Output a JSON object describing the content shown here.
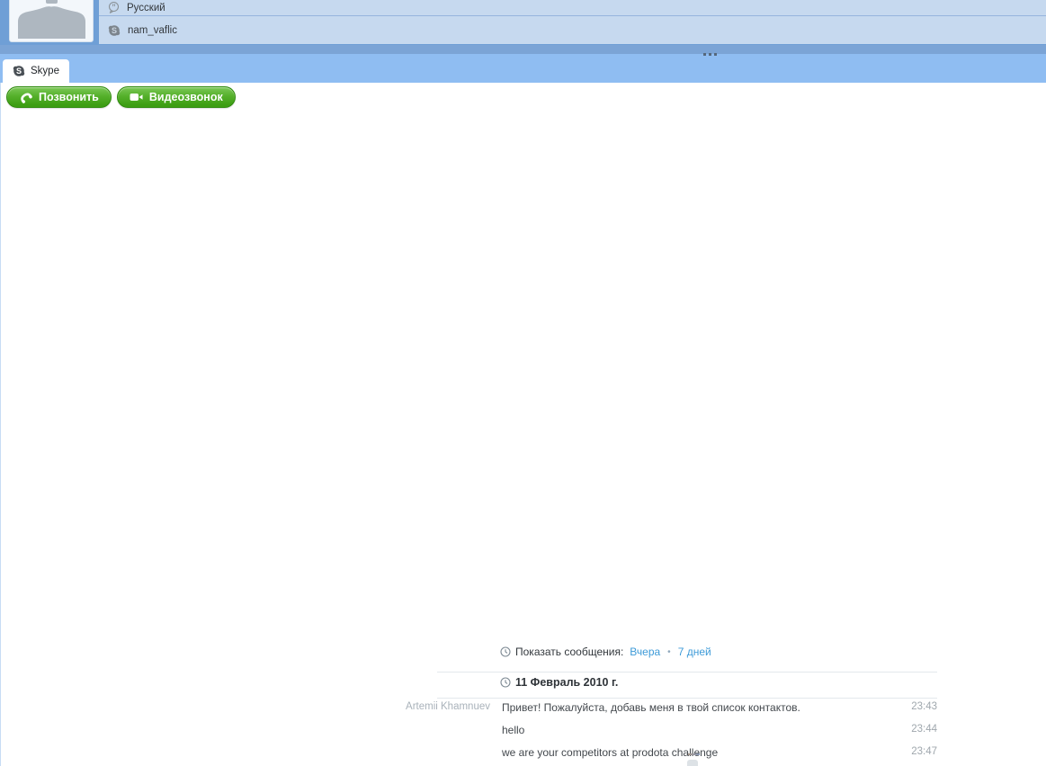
{
  "header": {
    "mood_message": "Русский",
    "skype_name": "nam_vaflic"
  },
  "tab": {
    "label": "Skype"
  },
  "toolbar": {
    "call_label": "Позвонить",
    "video_call_label": "Видеозвонок"
  },
  "history": {
    "show_messages_label": "Показать сообщения:",
    "link_yesterday": "Вчера",
    "separator": "•",
    "link_7days": "7 дней",
    "date_header": "11 Февраль 2010 г.",
    "messages": [
      {
        "author": "Artemii Khamnuev",
        "text": "Привет! Пожалуйста, добавь меня в твой список контактов.",
        "time": "23:43"
      },
      {
        "author": "",
        "text": "hello",
        "time": "23:44"
      },
      {
        "author": "",
        "text": "we are your competitors at prodota challenge",
        "time": "23:47"
      }
    ]
  },
  "icons": {
    "avatar": "default-person-silhouette",
    "mood": "speech-bubble",
    "skype": "skype-cloud",
    "clock": "clock",
    "call": "phone-handset",
    "video": "video-camera"
  },
  "colors": {
    "header_blue": "#6F9FD6",
    "row_blue": "#C6D9EF",
    "strip_blue": "#7BA4D6",
    "tabbar_blue": "#8FBDF2",
    "button_green_top": "#7CC857",
    "button_green_bottom": "#3D9E13",
    "link_blue": "#3E9BD8",
    "muted_gray": "#A9B2BA",
    "divider_gray": "#E3E8EC"
  }
}
